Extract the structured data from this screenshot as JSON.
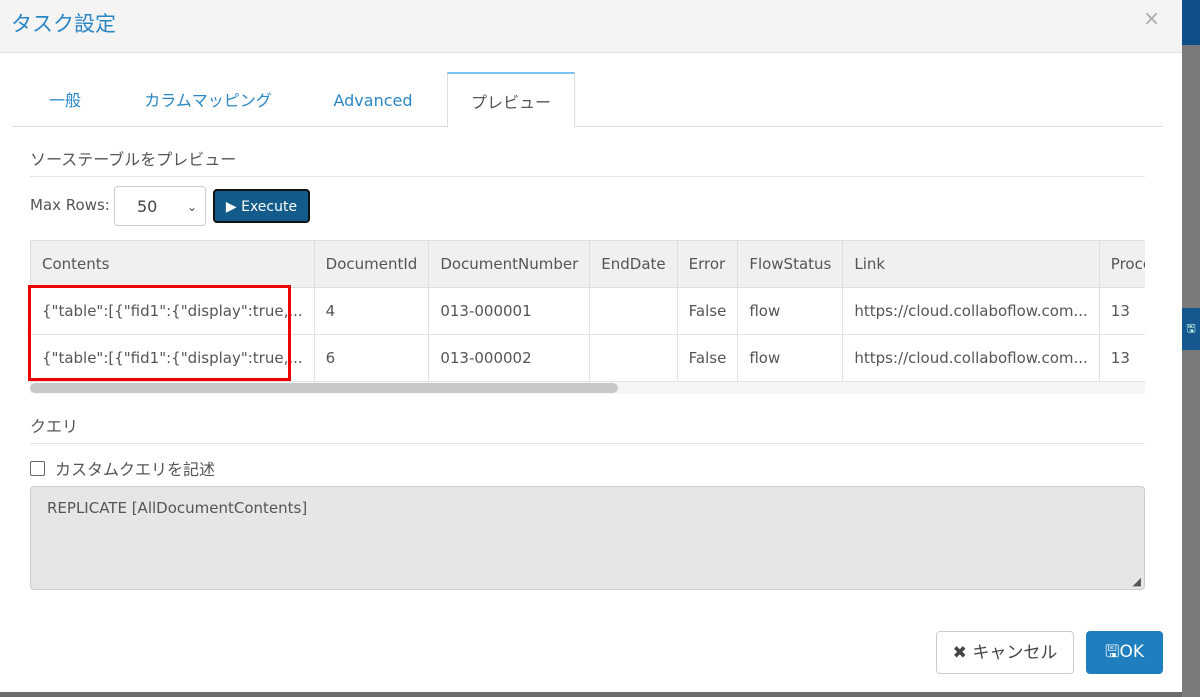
{
  "dialog": {
    "title": "タスク設定",
    "close": "×"
  },
  "tabs": [
    {
      "label": "一般"
    },
    {
      "label": "カラムマッピング"
    },
    {
      "label": "Advanced"
    },
    {
      "label": "プレビュー"
    }
  ],
  "preview": {
    "section_title": "ソーステーブルをプレビュー",
    "max_rows_label": "Max Rows:",
    "max_rows_value": "50",
    "execute_label": "▶ Execute"
  },
  "table": {
    "columns": [
      "Contents",
      "DocumentId",
      "DocumentNumber",
      "EndDate",
      "Error",
      "FlowStatus",
      "Link",
      "Proce"
    ],
    "rows": [
      [
        "{\"table\":[{\"fid1\":{\"display\":true,...",
        "4",
        "013-000001",
        "",
        "False",
        "flow",
        "https://cloud.collaboflow.com...",
        "13"
      ],
      [
        "{\"table\":[{\"fid1\":{\"display\":true,...",
        "6",
        "013-000002",
        "",
        "False",
        "flow",
        "https://cloud.collaboflow.com...",
        "13"
      ]
    ]
  },
  "query": {
    "section_title": "クエリ",
    "custom_query_label": "カスタムクエリを記述",
    "custom_query_checked": false,
    "text": "REPLICATE [AllDocumentContents]"
  },
  "footer": {
    "cancel_label": "キャンセル",
    "ok_label": "OK"
  },
  "colors": {
    "accent": "#2a86c5",
    "execute": "#135b8a",
    "ok": "#1f7ebd",
    "highlight": "#e00000"
  }
}
